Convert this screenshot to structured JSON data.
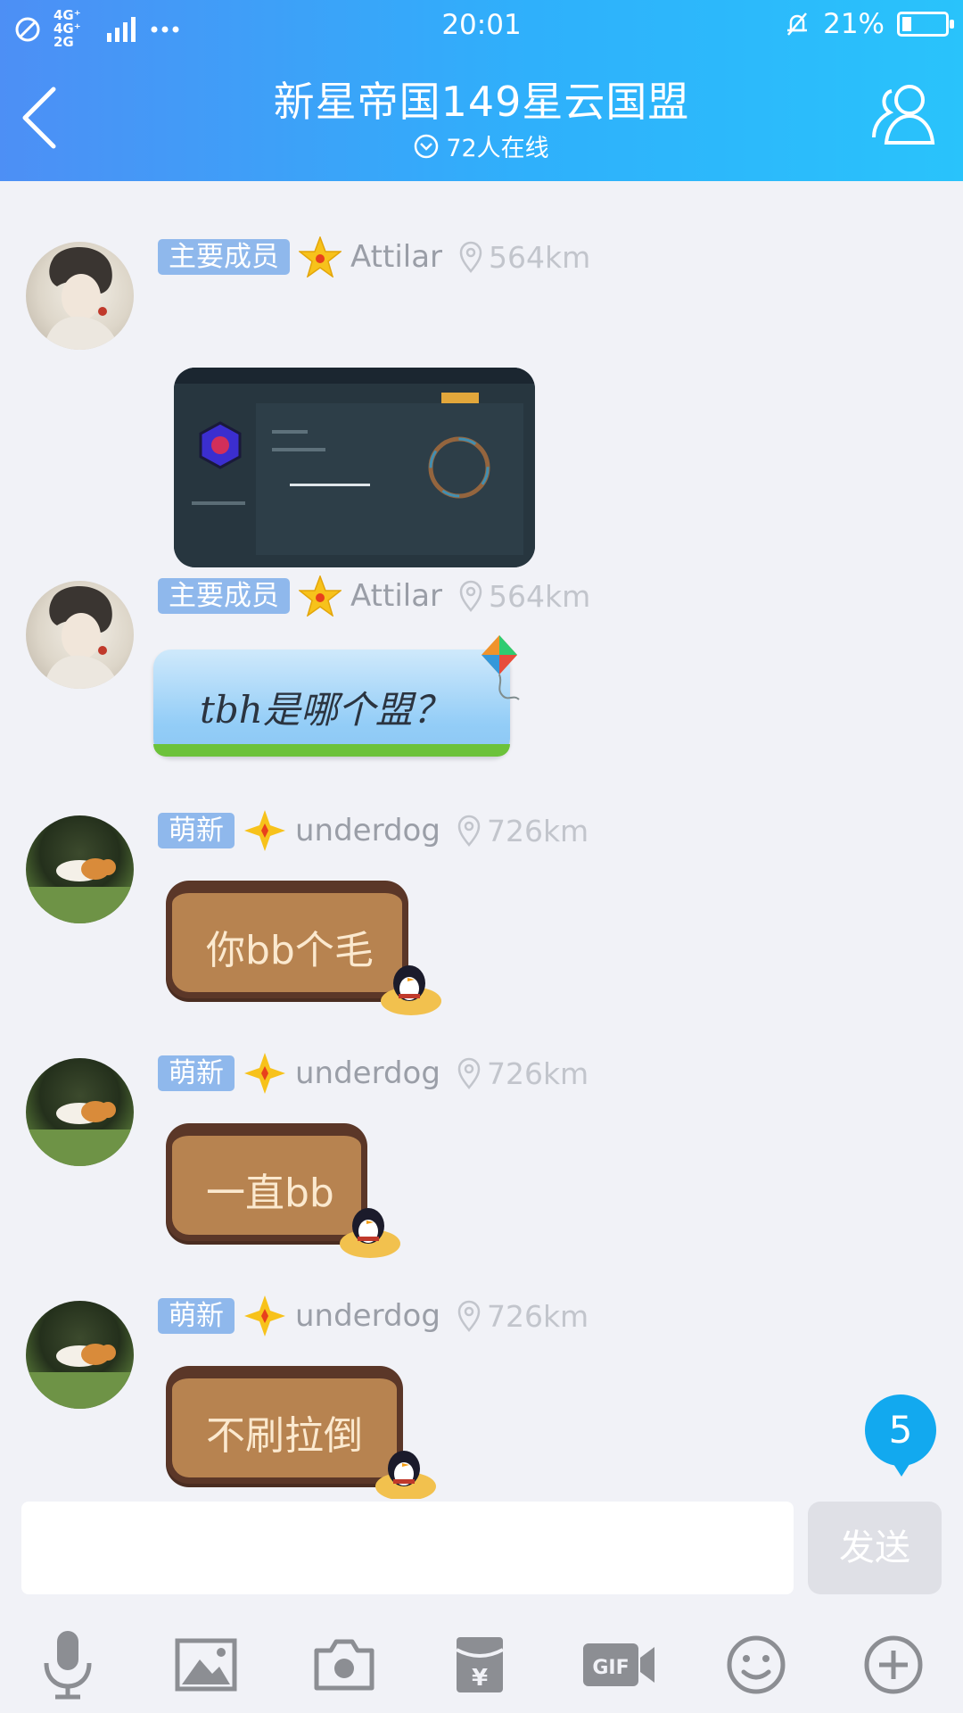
{
  "status_bar": {
    "network": "4G⁺ 4G⁺\n2G",
    "time": "20:01",
    "battery": "21%",
    "battery_level": 0.21
  },
  "header": {
    "title": "新星帝国149星云国盟",
    "online": "72人在线"
  },
  "messages": [
    {
      "badge": "主要成员",
      "username": "Attilar",
      "distance": "564km",
      "rank_icon": "gold-star-icon",
      "type": "image"
    },
    {
      "badge": "主要成员",
      "username": "Attilar",
      "distance": "564km",
      "rank_icon": "gold-star-icon",
      "type": "text",
      "text": "tbh是哪个盟？"
    },
    {
      "badge": "萌新",
      "username": "underdog",
      "distance": "726km",
      "rank_icon": "four-point-star-icon",
      "type": "text",
      "text": "你bb个毛"
    },
    {
      "badge": "萌新",
      "username": "underdog",
      "distance": "726km",
      "rank_icon": "four-point-star-icon",
      "type": "text",
      "text": "一直bb"
    },
    {
      "badge": "萌新",
      "username": "underdog",
      "distance": "726km",
      "rank_icon": "four-point-star-icon",
      "type": "text",
      "text": "不刷拉倒"
    }
  ],
  "unread_count": "5",
  "input": {
    "value": "",
    "placeholder": "",
    "send_label": "发送"
  },
  "toolbar": [
    "microphone-icon",
    "image-icon",
    "camera-icon",
    "red-packet-icon",
    "gif-icon",
    "emoji-icon",
    "plus-icon"
  ],
  "colors": {
    "header_start": "#4d8ff5",
    "header_end": "#29c3fb",
    "badge": "#8fb8ec",
    "unread": "#12a9ef",
    "background": "#f1f2f7"
  }
}
